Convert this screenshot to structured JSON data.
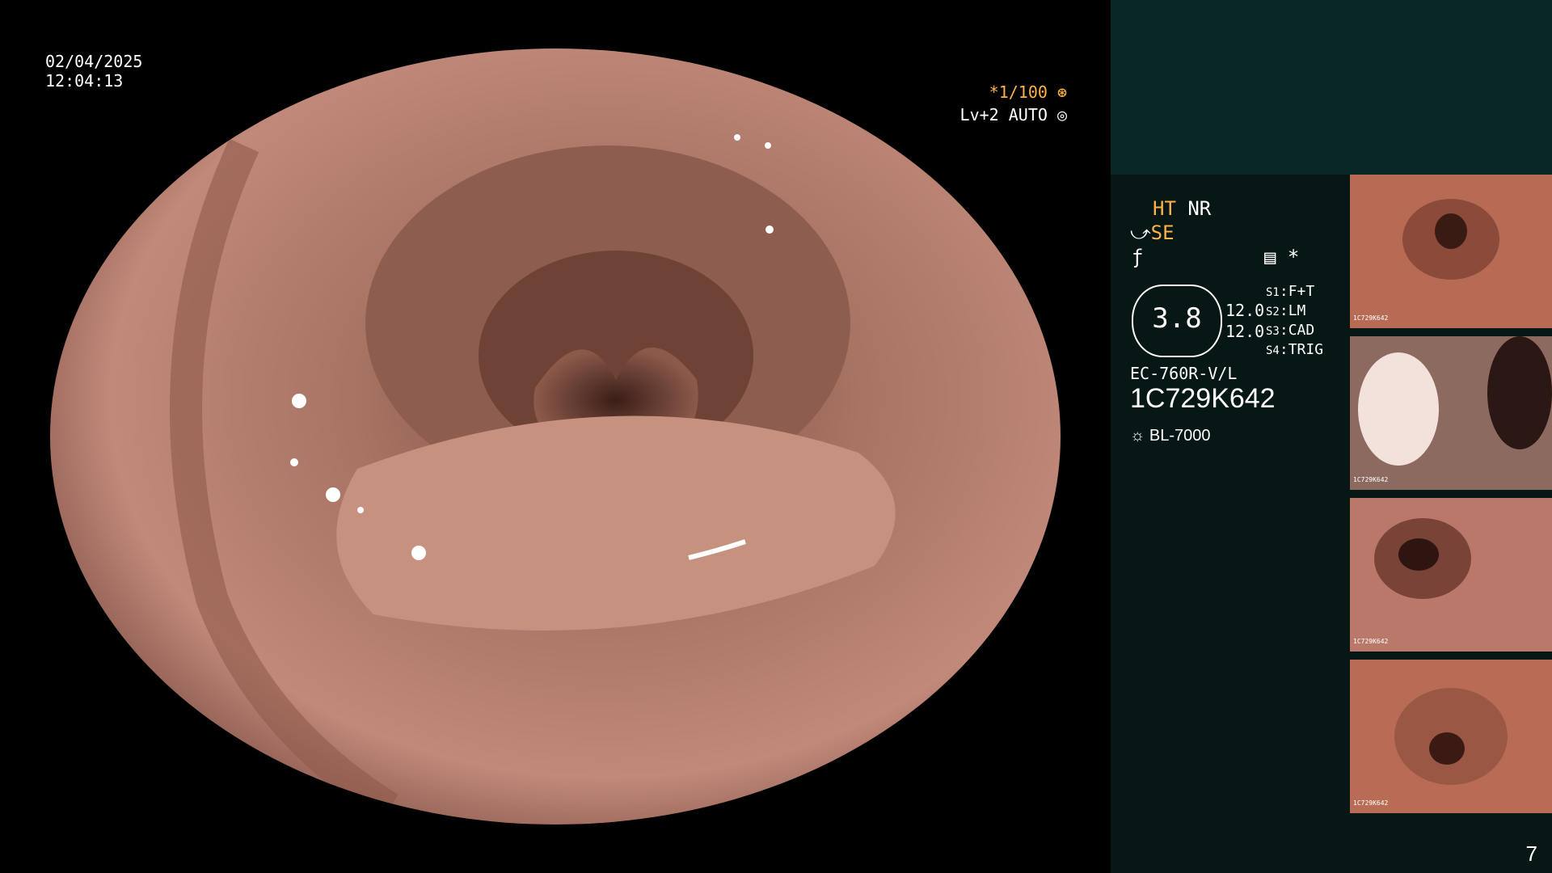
{
  "overlay": {
    "date": "02/04/2025",
    "time": "12:04:13",
    "shutter": "*1/100",
    "level": "Lv+2 AUTO"
  },
  "panel": {
    "ht": "HT",
    "nr": "NR",
    "se": "SE",
    "gauge_value": "3.8",
    "value_1": "12.0",
    "value_2": "12.0",
    "s1_key": "S1",
    "s1_val": "F+T",
    "s2_key": "S2",
    "s2_val": "LM",
    "s3_key": "S3",
    "s3_val": "CAD",
    "s4_key": "S4",
    "s4_val": "TRIG",
    "scope_model": "EC-760R-V/L",
    "serial": "1C729K642",
    "light_source": "BL-7000",
    "star": "*"
  },
  "thumbnails": [
    {
      "label": "1C729K642"
    },
    {
      "label": "1C729K642"
    },
    {
      "label": "1C729K642"
    },
    {
      "label": "1C729K642"
    }
  ],
  "page_number": "7",
  "colors": {
    "accent_orange": "#ffb347",
    "panel_top": "#092726",
    "panel_bottom": "#061716",
    "tissue": "#b47b6a"
  }
}
